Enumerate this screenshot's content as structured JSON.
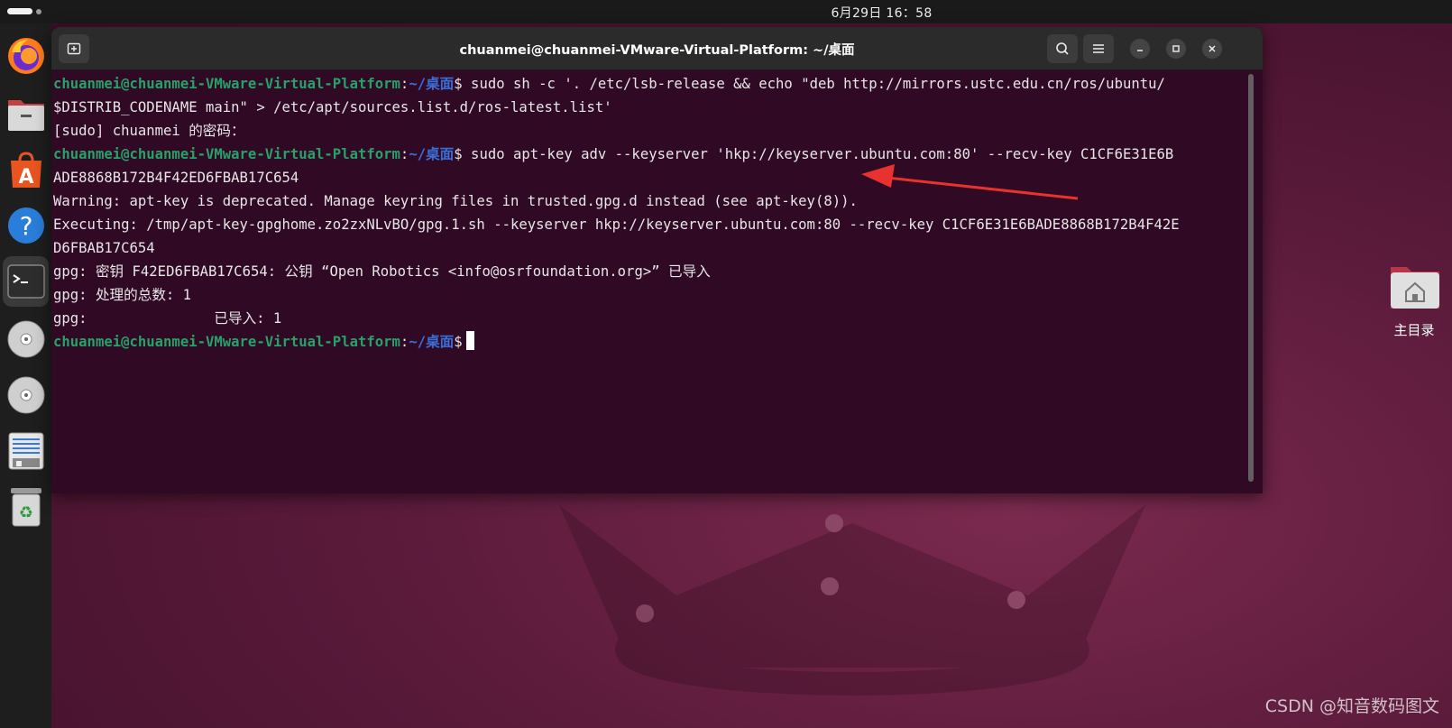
{
  "topbar": {
    "clock": "6月29日 16：58"
  },
  "dock": {
    "items": [
      {
        "icon": "firefox-icon"
      },
      {
        "icon": "files-icon"
      },
      {
        "icon": "app-center-icon"
      },
      {
        "icon": "help-icon"
      },
      {
        "icon": "terminal-icon",
        "active": true
      },
      {
        "icon": "disc-icon"
      },
      {
        "icon": "disc-icon"
      },
      {
        "icon": "text-editor-icon"
      },
      {
        "icon": "trash-icon"
      }
    ]
  },
  "desktop": {
    "home_label": "主目录",
    "watermark": "CSDN @知音数码图文"
  },
  "terminal": {
    "title": "chuanmei@chuanmei-VMware-Virtual-Platform: ~/桌面",
    "prompt_user": "chuanmei@chuanmei-VMware-Virtual-Platform",
    "prompt_sep": ":",
    "prompt_path": "~/桌面",
    "prompt_sym": "$",
    "cmd1": " sudo sh -c '. /etc/lsb-release && echo \"deb http://mirrors.ustc.edu.cn/ros/ubuntu/",
    "cmd1_cont": "$DISTRIB_CODENAME main\" > /etc/apt/sources.list.d/ros-latest.list'",
    "out1": "[sudo] chuanmei 的密码：",
    "cmd2": " sudo apt-key adv --keyserver 'hkp://keyserver.ubuntu.com:80' --recv-key C1CF6E31E6B",
    "cmd2_cont": "ADE8868B172B4F42ED6FBAB17C654",
    "out2": "Warning: apt-key is deprecated. Manage keyring files in trusted.gpg.d instead (see apt-key(8)).",
    "out3": "Executing: /tmp/apt-key-gpghome.zo2zxNLvBO/gpg.1.sh --keyserver hkp://keyserver.ubuntu.com:80 --recv-key C1CF6E31E6BADE8868B172B4F42E",
    "out3_cont": "D6FBAB17C654",
    "out4": "gpg: 密钥 F42ED6FBAB17C654: 公钥 “Open Robotics <info@osrfoundation.org>” 已导入",
    "out5": "gpg: 处理的总数: 1",
    "out6": "gpg:               已导入: 1"
  },
  "colors": {
    "terminal_bg": "#300a24",
    "prompt_user": "#26a269",
    "prompt_path": "#3a6fd8",
    "annotation_arrow": "#e8322d"
  }
}
